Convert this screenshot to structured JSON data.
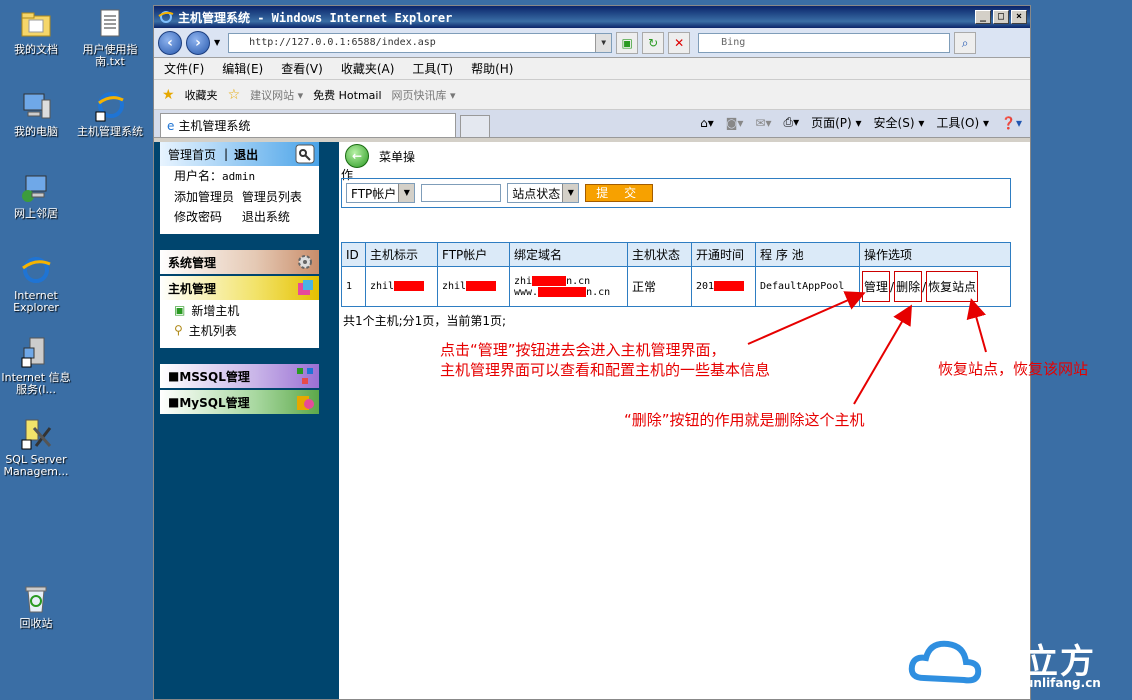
{
  "desktop": {
    "icons": [
      {
        "label": "我的文档"
      },
      {
        "label": "用户使用指南.txt"
      },
      {
        "label": "我的电脑"
      },
      {
        "label": "主机管理系统"
      },
      {
        "label": "网上邻居"
      },
      {
        "label": "Internet Explorer"
      },
      {
        "label": "Internet 信息服务(I..."
      },
      {
        "label": "SQL Server Managem..."
      },
      {
        "label": "回收站"
      }
    ]
  },
  "window": {
    "title": "主机管理系统 - Windows Internet Explorer",
    "address": "http://127.0.0.1:6588/index.asp",
    "search_placeholder": "Bing",
    "menu": [
      "文件(F)",
      "编辑(E)",
      "查看(V)",
      "收藏夹(A)",
      "工具(T)",
      "帮助(H)"
    ],
    "favorites": {
      "label": "收藏夹",
      "items": [
        "建议网站 ▾",
        "免费 Hotmail",
        "网页快讯库 ▾"
      ]
    },
    "tab_title": "主机管理系统",
    "tools": [
      "页面(P) ▾",
      "安全(S) ▾",
      "工具(O) ▾"
    ]
  },
  "sidebar": {
    "home": "管理首页",
    "logout": "退出",
    "username_label": "用户名：",
    "username": "admin",
    "links": [
      "添加管理员",
      "管理员列表",
      "修改密码",
      "退出系统"
    ],
    "system": "系统管理",
    "host": "主机管理",
    "host_items": [
      "新增主机",
      "主机列表"
    ],
    "mssql": "MSSQL管理",
    "mysql": "MySQL管理"
  },
  "main": {
    "title": "菜单操",
    "title_suffix": "作",
    "filter": {
      "field": "FTP帐户",
      "status": "站点状态",
      "submit": "提 交"
    },
    "table": {
      "headers": [
        "ID",
        "主机标示",
        "FTP帐户",
        "绑定域名",
        "主机状态",
        "开通时间",
        "程 序 池",
        "操作选项"
      ],
      "row": {
        "id": "1",
        "host": "zhil",
        "ftp": "zhil",
        "domain1": "zhi",
        "domain1_end": "n.cn",
        "domain2": "www.",
        "domain2_end": "n.cn",
        "status": "正常",
        "opened": "201",
        "pool": "DefaultAppPool",
        "ops": [
          "管理",
          "删除",
          "恢复站点"
        ]
      }
    },
    "summary": "共1个主机;分1页，当前第1页;"
  },
  "annotations": {
    "manage": [
      "点击“管理”按钮进去会进入主机管理界面，",
      "主机管理界面可以查看和配置主机的一些基本信息"
    ],
    "delete": "“删除”按钮的作用就是删除这个主机",
    "restore": "恢复站点，恢复该网站"
  },
  "watermark": {
    "brand": "云立方",
    "url": "www.yunlifang.cn"
  }
}
